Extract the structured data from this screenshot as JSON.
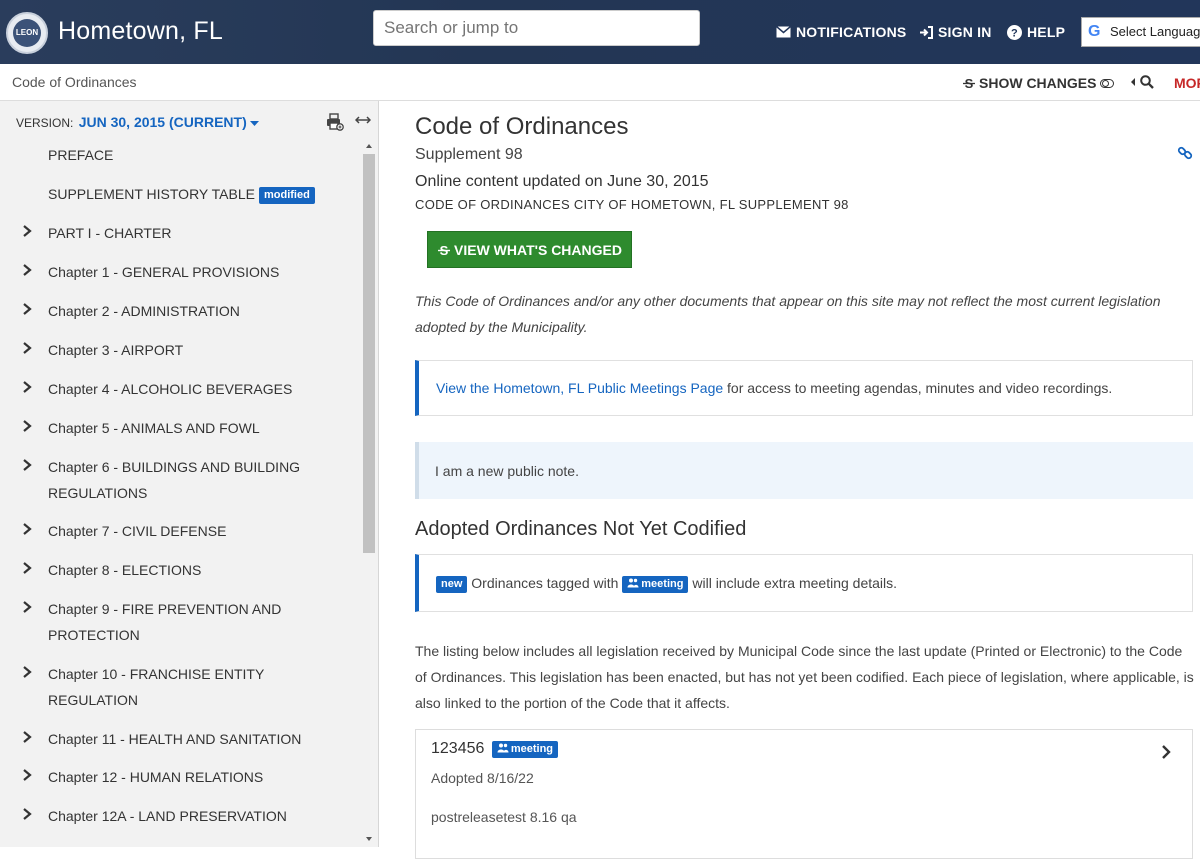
{
  "header": {
    "logo_text": "LEON",
    "site_title": "Hometown, FL",
    "search_placeholder": "Search or jump to",
    "notifications_label": "NOTIFICATIONS",
    "signin_label": "SIGN IN",
    "help_label": "HELP",
    "language_label": "Select Language"
  },
  "subbar": {
    "breadcrumb": "Code of Ordinances",
    "show_changes_label": "SHOW CHANGES",
    "more_label": "MORE"
  },
  "sidebar": {
    "version_prefix": "VERSION:",
    "version_value": "JUN 30, 2015 (CURRENT)",
    "items": [
      {
        "label": "PREFACE",
        "badge": "",
        "expandable": false
      },
      {
        "label": "SUPPLEMENT HISTORY TABLE",
        "badge": "modified",
        "expandable": false
      },
      {
        "label": "PART I - CHARTER",
        "badge": "",
        "expandable": true
      },
      {
        "label": "Chapter 1 - GENERAL PROVISIONS",
        "badge": "",
        "expandable": true
      },
      {
        "label": "Chapter 2 - ADMINISTRATION",
        "badge": "",
        "expandable": true
      },
      {
        "label": "Chapter 3 - AIRPORT",
        "badge": "",
        "expandable": true
      },
      {
        "label": "Chapter 4 - ALCOHOLIC BEVERAGES",
        "badge": "",
        "expandable": true
      },
      {
        "label": "Chapter 5 - ANIMALS AND FOWL",
        "badge": "",
        "expandable": true
      },
      {
        "label": "Chapter 6 - BUILDINGS AND BUILDING REGULATIONS",
        "badge": "",
        "expandable": true
      },
      {
        "label": "Chapter 7 - CIVIL DEFENSE",
        "badge": "",
        "expandable": true
      },
      {
        "label": "Chapter 8 - ELECTIONS",
        "badge": "",
        "expandable": true
      },
      {
        "label": "Chapter 9 - FIRE PREVENTION AND PROTECTION",
        "badge": "",
        "expandable": true
      },
      {
        "label": "Chapter 10 - FRANCHISE ENTITY REGULATION",
        "badge": "",
        "expandable": true
      },
      {
        "label": "Chapter 11 - HEALTH AND SANITATION",
        "badge": "",
        "expandable": true
      },
      {
        "label": "Chapter 12 - HUMAN RELATIONS",
        "badge": "",
        "expandable": true
      },
      {
        "label": "Chapter 12A - LAND PRESERVATION",
        "badge": "",
        "expandable": true
      }
    ]
  },
  "main": {
    "title": "Code of Ordinances",
    "supplement": "Supplement 98",
    "updated": "Online content updated on June 30, 2015",
    "code_line": "CODE OF ORDINANCES CITY OF HOMETOWN, FL SUPPLEMENT 98",
    "view_changed_label": "VIEW WHAT'S CHANGED",
    "disclaimer": "This Code of Ordinances and/or any other documents that appear on this site may not reflect the most current legislation adopted by the Municipality.",
    "meetings_link": "View the Hometown, FL Public Meetings Page",
    "meetings_rest": " for access to meeting agendas, minutes and video recordings.",
    "public_note": "I am a new public note.",
    "adopted_heading": "Adopted Ordinances Not Yet Codified",
    "new_badge": "new",
    "tagged_text": " Ordinances tagged with ",
    "meeting_badge": "meeting",
    "tagged_rest": " will include extra meeting details.",
    "listing_text": "The listing below includes all legislation received by Municipal Code since the last update (Printed or Electronic) to the Code of Ordinances. This legislation has been enacted, but has not yet been codified. Each piece of legislation, where applicable, is also linked to the portion of the Code that it affects.",
    "ordinance": {
      "number": "123456",
      "badge": "meeting",
      "adopted": "Adopted 8/16/22",
      "description": "postreleasetest 8.16 qa"
    }
  }
}
